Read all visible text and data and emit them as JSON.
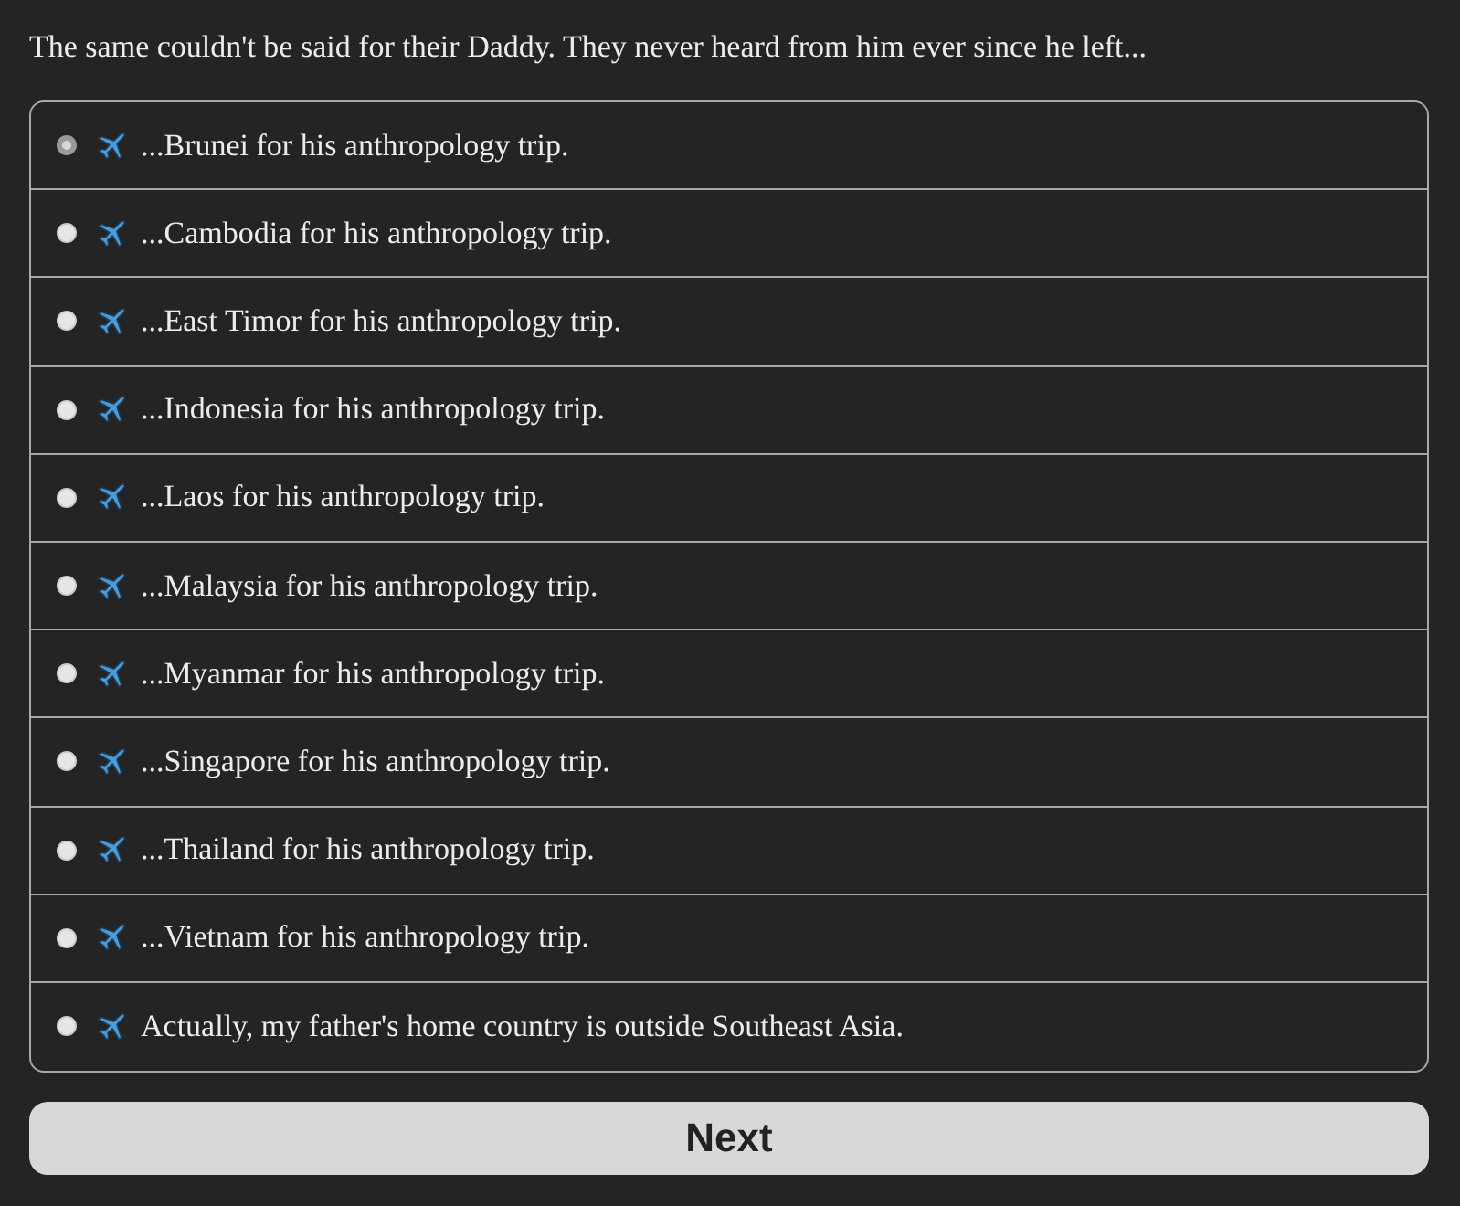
{
  "intro": "The same couldn't be said for their Daddy. They never heard from him ever since he left...",
  "options": [
    {
      "label": "...Brunei for his anthropology trip.",
      "selected": true
    },
    {
      "label": "...Cambodia for his anthropology trip.",
      "selected": false
    },
    {
      "label": "...East Timor for his anthropology trip.",
      "selected": false
    },
    {
      "label": "...Indonesia for his anthropology trip.",
      "selected": false
    },
    {
      "label": "...Laos for his anthropology trip.",
      "selected": false
    },
    {
      "label": "...Malaysia for his anthropology trip.",
      "selected": false
    },
    {
      "label": "...Myanmar for his anthropology trip.",
      "selected": false
    },
    {
      "label": "...Singapore for his anthropology trip.",
      "selected": false
    },
    {
      "label": "...Thailand for his anthropology trip.",
      "selected": false
    },
    {
      "label": "...Vietnam for his anthropology trip.",
      "selected": false
    },
    {
      "label": "Actually, my father's home country is outside Southeast Asia.",
      "selected": false
    }
  ],
  "next_button": {
    "label": "Next"
  }
}
